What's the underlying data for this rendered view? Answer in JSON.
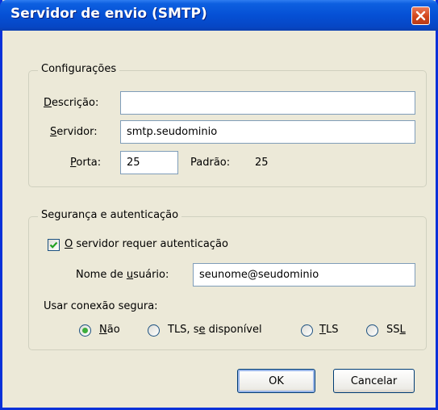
{
  "window": {
    "title": "Servidor de envio (SMTP)"
  },
  "config": {
    "legend": "Configurações",
    "descricao_label": "Descrição:",
    "descricao_value": "",
    "servidor_label": "Servidor:",
    "servidor_value": "smtp.seudominio",
    "porta_label": "Porta:",
    "porta_value": "25",
    "padrao_label": "Padrão:",
    "padrao_value": "25"
  },
  "security": {
    "legend": "Segurança e autenticação",
    "auth_label": "O servidor requer autenticação",
    "auth_checked": true,
    "username_label": "Nome de usuário:",
    "username_value": "seunome@seudominio",
    "secure_label": "Usar conexão segura:",
    "options": [
      "Não",
      "TLS, se disponível",
      "TLS",
      "SSL"
    ],
    "selected_option": "Não"
  },
  "buttons": {
    "ok": "OK",
    "cancel": "Cancelar"
  },
  "colors": {
    "titlebar": "#0550d5",
    "dialog_bg": "#ece9d8",
    "radio_dot": "#3dae3d",
    "checkmark": "#21a121",
    "close_button": "#d2451a"
  }
}
